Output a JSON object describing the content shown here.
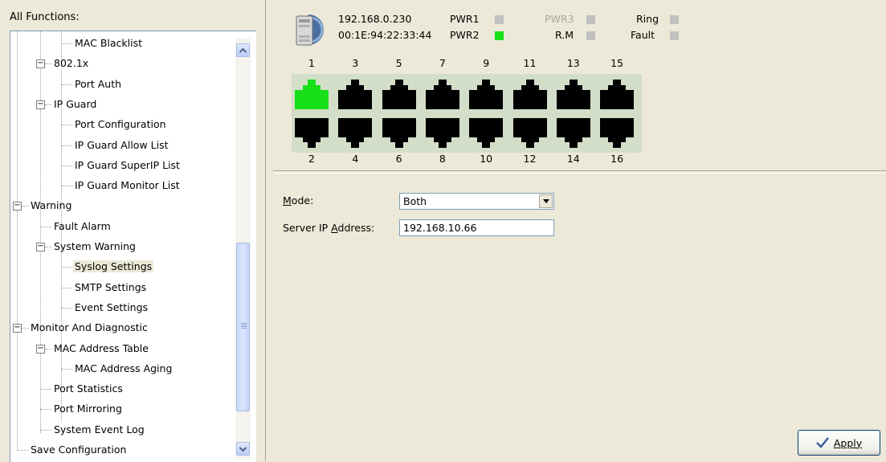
{
  "sidebar": {
    "title": "All Functions:",
    "tree": [
      {
        "label": "MAC Blacklist",
        "level": 2,
        "expander": null
      },
      {
        "label": "802.1x",
        "level": 1,
        "expander": "minus"
      },
      {
        "label": "Port Auth",
        "level": 2,
        "expander": null
      },
      {
        "label": "IP Guard",
        "level": 1,
        "expander": "minus"
      },
      {
        "label": "Port Configuration",
        "level": 2,
        "expander": null
      },
      {
        "label": "IP Guard Allow List",
        "level": 2,
        "expander": null
      },
      {
        "label": "IP Guard SuperIP List",
        "level": 2,
        "expander": null
      },
      {
        "label": "IP Guard Monitor List",
        "level": 2,
        "expander": null
      },
      {
        "label": "Warning",
        "level": 0,
        "expander": "minus"
      },
      {
        "label": "Fault Alarm",
        "level": 1,
        "expander": null
      },
      {
        "label": "System Warning",
        "level": 1,
        "expander": "minus"
      },
      {
        "label": "Syslog Settings",
        "level": 2,
        "expander": null,
        "selected": true
      },
      {
        "label": "SMTP Settings",
        "level": 2,
        "expander": null
      },
      {
        "label": "Event Settings",
        "level": 2,
        "expander": null
      },
      {
        "label": "Monitor And Diagnostic",
        "level": 0,
        "expander": "minus"
      },
      {
        "label": "MAC Address Table",
        "level": 1,
        "expander": "minus"
      },
      {
        "label": "MAC Address Aging",
        "level": 2,
        "expander": null
      },
      {
        "label": "Port Statistics",
        "level": 1,
        "expander": null
      },
      {
        "label": "Port Mirroring",
        "level": 1,
        "expander": null
      },
      {
        "label": "System Event Log",
        "level": 1,
        "expander": null
      },
      {
        "label": "Save Configuration",
        "level": 0,
        "expander": null
      }
    ]
  },
  "device": {
    "ip": "192.168.0.230",
    "mac": "00:1E:94:22:33:44",
    "icon": "switch-device-icon",
    "indicators": [
      {
        "label": "PWR1",
        "on": false,
        "dim": false
      },
      {
        "label": "PWR3",
        "on": false,
        "dim": true
      },
      {
        "label": "Ring",
        "on": false,
        "dim": false
      },
      {
        "label": "PWR2",
        "on": true,
        "dim": false
      },
      {
        "label": "R.M",
        "on": false,
        "dim": false
      },
      {
        "label": "Fault",
        "on": false,
        "dim": false
      }
    ],
    "top_ports": [
      "1",
      "3",
      "5",
      "7",
      "9",
      "11",
      "13",
      "15"
    ],
    "bottom_ports": [
      "2",
      "4",
      "6",
      "8",
      "10",
      "12",
      "14",
      "16"
    ],
    "active_ports": [
      "1"
    ],
    "colors": {
      "active": "#18e018",
      "inactive": "#000000",
      "panel": "#d3dec9"
    }
  },
  "form": {
    "mode_label": "Mode:",
    "mode_accesskey": "M",
    "mode_value": "Both",
    "server_ip_label": "Server IP Address:",
    "server_ip_accesskey": "A",
    "server_ip_value": "192.168.10.66"
  },
  "actions": {
    "apply_label": "Apply",
    "apply_icon": "checkmark-icon"
  }
}
